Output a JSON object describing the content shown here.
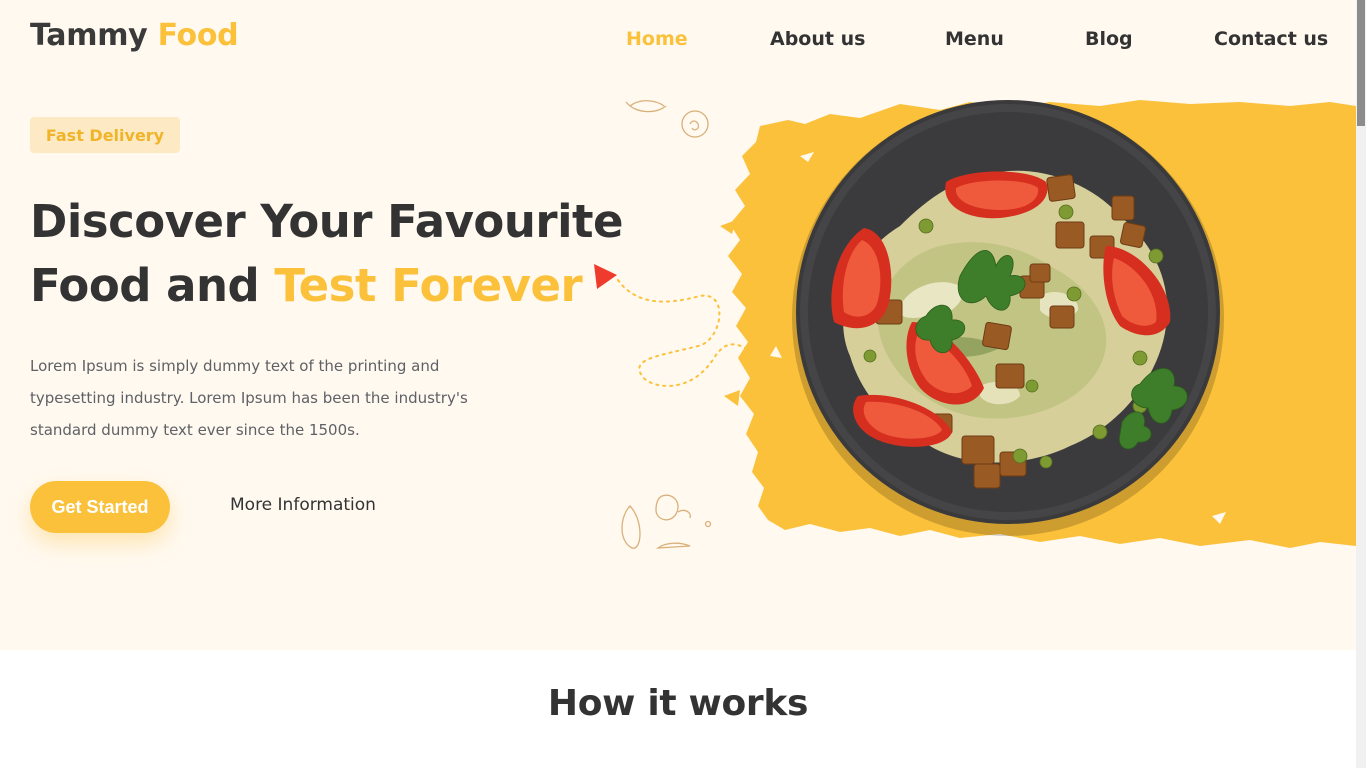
{
  "brand": {
    "name_part1": "Tammy",
    "name_part2": "Food"
  },
  "nav": {
    "items": [
      {
        "label": "Home",
        "active": true
      },
      {
        "label": "About us",
        "active": false
      },
      {
        "label": "Menu",
        "active": false
      },
      {
        "label": "Blog",
        "active": false
      },
      {
        "label": "Contact us",
        "active": false
      }
    ]
  },
  "hero": {
    "badge": "Fast Delivery",
    "headline_line1": "Discover Your Favourite",
    "headline_line2_plain": "Food and",
    "headline_line2_accent": "Test Forever",
    "description": "Lorem Ipsum is simply dummy text of the printing and typesetting industry. Lorem Ipsum has been the industry's standard dummy text ever since the 1500s.",
    "primary_button": "Get Started",
    "secondary_link": "More Information"
  },
  "how_it_works": {
    "title": "How it works"
  },
  "colors": {
    "accent": "#fbc13a",
    "hero_bg": "#fff9f0",
    "badge_bg": "#fdeac4",
    "text_dark": "#333333",
    "plate": "#3a3a3c",
    "triangle": "#ef3b2d"
  },
  "icons": [
    "food-doodle-icons",
    "play-triangle-icon"
  ]
}
